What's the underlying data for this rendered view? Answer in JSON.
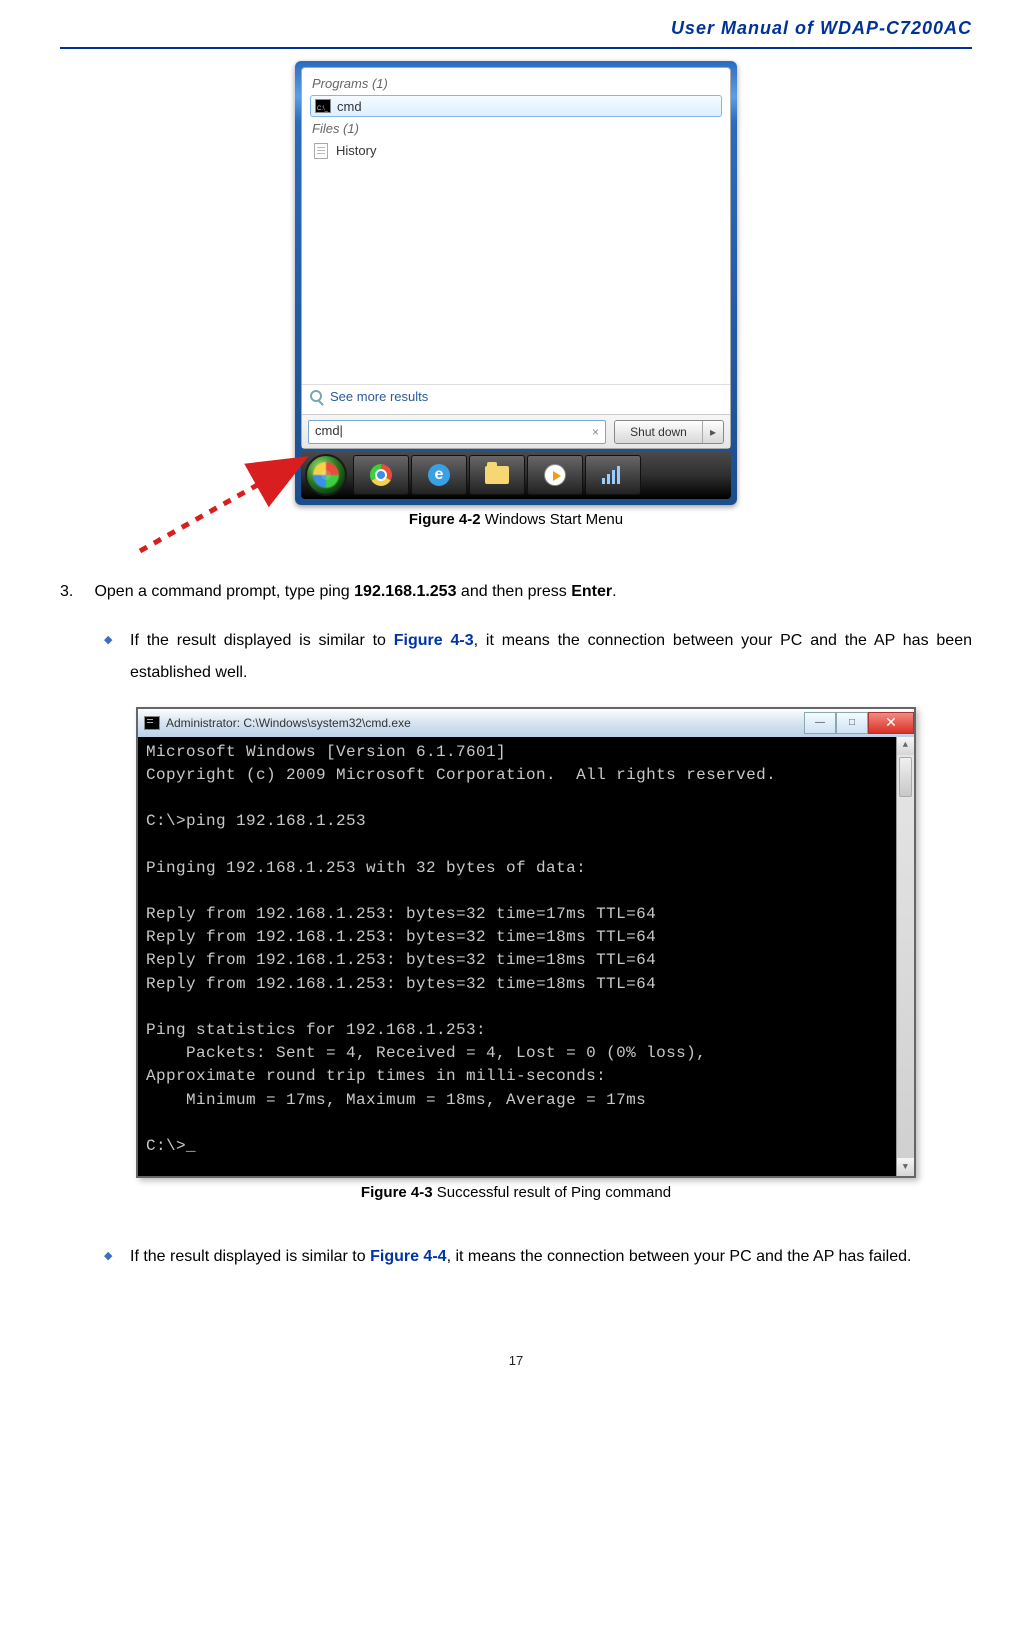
{
  "header": {
    "title": "User  Manual  of  WDAP-C7200AC"
  },
  "startmenu": {
    "programs_label": "Programs (1)",
    "program_item": "cmd",
    "files_label": "Files (1)",
    "file_item": "History",
    "see_more": "See more results",
    "search_value": "cmd|",
    "shutdown_label": "Shut down"
  },
  "fig42": {
    "caption_bold": "Figure 4-2",
    "caption_rest": " Windows Start Menu"
  },
  "step3": {
    "num": "3.",
    "text_before_ip": "Open a command prompt, type ping ",
    "ip": "192.168.1.253",
    "text_mid": " and then press ",
    "enter": "Enter",
    "period": "."
  },
  "bullet1": {
    "pre": "If the result displayed is similar to ",
    "ref": "Figure 4-3",
    "post": ", it means the connection between your PC and the AP has been established well."
  },
  "cmd": {
    "title": "Administrator: C:\\Windows\\system32\\cmd.exe",
    "lines": [
      "Microsoft Windows [Version 6.1.7601]",
      "Copyright (c) 2009 Microsoft Corporation.  All rights reserved.",
      "",
      "C:\\>ping 192.168.1.253",
      "",
      "Pinging 192.168.1.253 with 32 bytes of data:",
      "",
      "Reply from 192.168.1.253: bytes=32 time=17ms TTL=64",
      "Reply from 192.168.1.253: bytes=32 time=18ms TTL=64",
      "Reply from 192.168.1.253: bytes=32 time=18ms TTL=64",
      "Reply from 192.168.1.253: bytes=32 time=18ms TTL=64",
      "",
      "Ping statistics for 192.168.1.253:",
      "    Packets: Sent = 4, Received = 4, Lost = 0 (0% loss),",
      "Approximate round trip times in milli-seconds:",
      "    Minimum = 17ms, Maximum = 18ms, Average = 17ms",
      "",
      "C:\\>_"
    ]
  },
  "fig43": {
    "caption_bold": "Figure 4-3",
    "caption_rest": " Successful result of Ping command"
  },
  "bullet2": {
    "pre": "If the result displayed is similar to ",
    "ref": "Figure 4-4",
    "post": ", it means the connection between your PC and the AP has failed."
  },
  "page_number": "17"
}
